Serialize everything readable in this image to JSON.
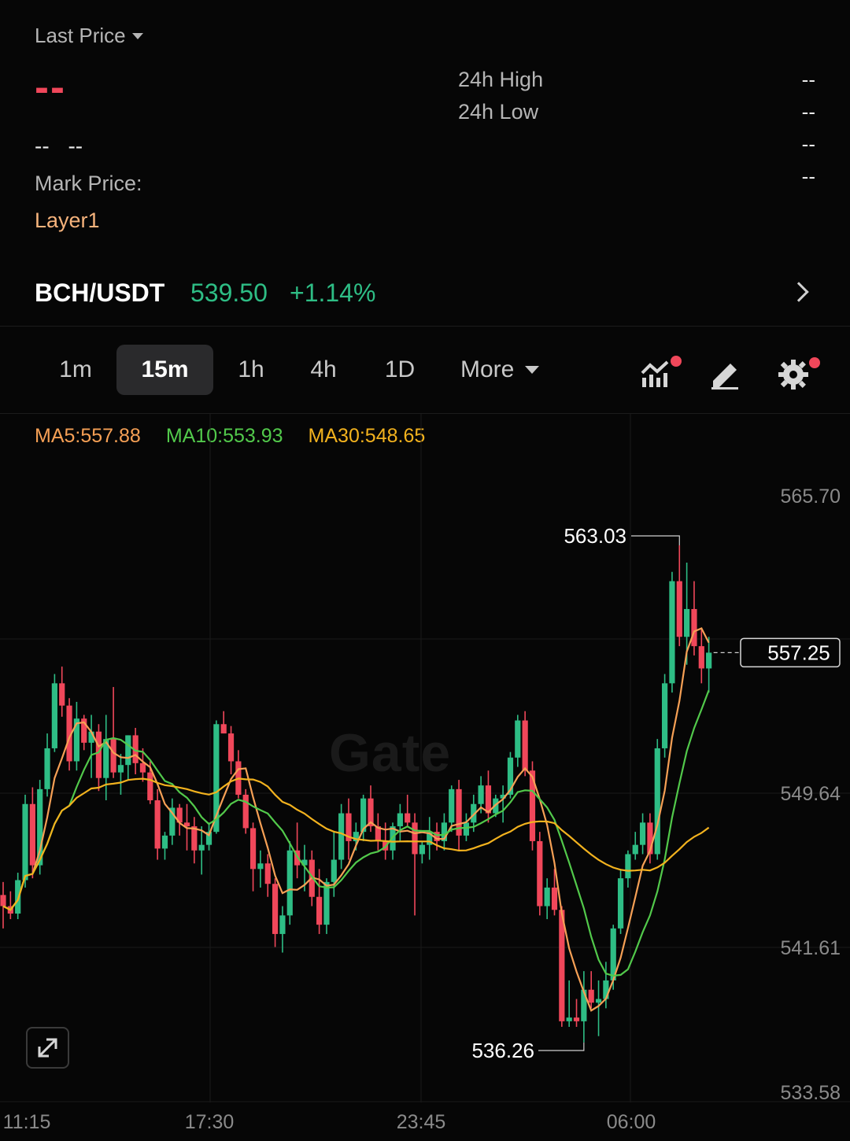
{
  "header": {
    "last_price_label": "Last Price",
    "last_price_value": "--",
    "change_left": "--",
    "change_right": "--",
    "mark_price_label": "Mark Price:",
    "tag": "Layer1",
    "stats": [
      {
        "label": "24h High",
        "value": "--"
      },
      {
        "label": "24h Low",
        "value": "--"
      },
      {
        "label": "",
        "value": "--"
      },
      {
        "label": "",
        "value": "--"
      }
    ]
  },
  "pair": {
    "symbol": "BCH/USDT",
    "price": "539.50",
    "change": "+1.14%"
  },
  "timeframes": {
    "items": [
      "1m",
      "15m",
      "1h",
      "4h",
      "1D"
    ],
    "active": "15m",
    "more_label": "More"
  },
  "tools": {
    "indicator_icon": "indicator-chart-icon",
    "draw_icon": "pencil-icon",
    "settings_icon": "gear-icon",
    "alert_color": "#f0475a"
  },
  "indicators": {
    "ma5": "MA5:557.88",
    "ma10": "MA10:553.93",
    "ma30": "MA30:548.65"
  },
  "watermark": "Gate",
  "chart_data": {
    "type": "candlestick",
    "up_color": "#2ebd85",
    "down_color": "#f0475a",
    "y_ticks": [
      "565.70",
      "549.64",
      "541.61",
      "533.58"
    ],
    "x_ticks": [
      "11:15",
      "17:30",
      "23:45",
      "06:00"
    ],
    "ylim": [
      533.58,
      565.7
    ],
    "current_price": "557.25",
    "max_label": "563.03",
    "min_label": "536.26",
    "ohlc": [
      [
        544.2,
        544.9,
        542.4,
        543.6
      ],
      [
        543.6,
        544.4,
        542.9,
        543.2
      ],
      [
        543.2,
        545.4,
        542.9,
        545.0
      ],
      [
        545.0,
        549.6,
        544.6,
        549.1
      ],
      [
        549.1,
        550.0,
        545.1,
        545.8
      ],
      [
        545.8,
        550.4,
        545.3,
        549.9
      ],
      [
        549.9,
        552.9,
        549.5,
        552.1
      ],
      [
        552.1,
        556.1,
        551.9,
        555.6
      ],
      [
        555.6,
        556.5,
        553.8,
        554.4
      ],
      [
        554.4,
        554.8,
        550.9,
        551.4
      ],
      [
        551.4,
        554.6,
        550.9,
        553.7
      ],
      [
        553.7,
        553.9,
        552.0,
        552.4
      ],
      [
        552.4,
        553.9,
        550.5,
        553.0
      ],
      [
        553.0,
        553.4,
        549.8,
        550.5
      ],
      [
        550.5,
        553.9,
        549.3,
        552.6
      ],
      [
        552.6,
        555.4,
        550.5,
        550.8
      ],
      [
        550.8,
        551.8,
        549.6,
        551.2
      ],
      [
        551.2,
        552.8,
        550.4,
        552.8
      ],
      [
        552.8,
        553.2,
        550.7,
        551.3
      ],
      [
        551.3,
        552.1,
        550.3,
        550.8
      ],
      [
        550.8,
        551.4,
        549.1,
        549.3
      ],
      [
        549.3,
        549.9,
        546.1,
        546.7
      ],
      [
        546.7,
        547.6,
        546.1,
        547.4
      ],
      [
        547.4,
        549.4,
        546.9,
        548.9
      ],
      [
        548.9,
        549.1,
        547.4,
        548.1
      ],
      [
        548.1,
        549.1,
        546.6,
        547.9
      ],
      [
        547.9,
        548.4,
        545.9,
        546.6
      ],
      [
        546.6,
        547.9,
        545.3,
        546.9
      ],
      [
        546.9,
        548.1,
        546.6,
        547.6
      ],
      [
        547.6,
        553.6,
        547.5,
        553.4
      ],
      [
        553.4,
        554.1,
        552.9,
        552.9
      ],
      [
        552.9,
        553.3,
        550.7,
        551.4
      ],
      [
        551.4,
        552.0,
        549.4,
        549.6
      ],
      [
        549.6,
        549.9,
        547.5,
        547.8
      ],
      [
        547.8,
        548.1,
        544.4,
        545.6
      ],
      [
        545.6,
        546.6,
        544.6,
        545.9
      ],
      [
        545.9,
        546.4,
        544.1,
        544.8
      ],
      [
        544.8,
        545.1,
        541.4,
        542.1
      ],
      [
        542.1,
        543.6,
        541.1,
        543.1
      ],
      [
        543.1,
        547.1,
        542.6,
        546.6
      ],
      [
        546.6,
        548.1,
        545.1,
        545.8
      ],
      [
        545.8,
        546.9,
        544.4,
        546.1
      ],
      [
        546.1,
        546.6,
        543.6,
        544.1
      ],
      [
        544.1,
        545.6,
        542.1,
        542.6
      ],
      [
        542.6,
        545.1,
        542.1,
        544.9
      ],
      [
        544.9,
        547.6,
        544.1,
        546.1
      ],
      [
        546.1,
        549.1,
        545.6,
        548.6
      ],
      [
        548.6,
        549.4,
        546.1,
        547.1
      ],
      [
        547.1,
        548.1,
        546.6,
        547.6
      ],
      [
        547.6,
        549.6,
        547.1,
        549.4
      ],
      [
        549.4,
        550.1,
        547.6,
        547.9
      ],
      [
        547.9,
        548.6,
        546.6,
        547.1
      ],
      [
        547.1,
        548.1,
        546.1,
        546.6
      ],
      [
        546.6,
        548.1,
        546.1,
        547.9
      ],
      [
        547.9,
        549.1,
        547.1,
        548.6
      ],
      [
        548.6,
        549.6,
        547.9,
        548.1
      ],
      [
        548.1,
        548.6,
        543.1,
        546.4
      ],
      [
        546.4,
        547.1,
        545.9,
        546.9
      ],
      [
        546.9,
        548.4,
        546.1,
        547.6
      ],
      [
        547.6,
        548.1,
        546.6,
        547.1
      ],
      [
        547.1,
        548.6,
        546.6,
        548.1
      ],
      [
        548.1,
        550.1,
        547.6,
        549.9
      ],
      [
        549.9,
        550.4,
        546.6,
        547.4
      ],
      [
        547.4,
        548.6,
        547.1,
        548.1
      ],
      [
        548.1,
        549.6,
        547.6,
        549.1
      ],
      [
        549.1,
        550.6,
        548.6,
        550.1
      ],
      [
        550.1,
        550.9,
        548.1,
        548.6
      ],
      [
        548.6,
        549.6,
        548.4,
        549.4
      ],
      [
        549.4,
        550.1,
        548.1,
        549.6
      ],
      [
        549.6,
        551.9,
        549.4,
        551.6
      ],
      [
        551.6,
        553.9,
        551.1,
        553.6
      ],
      [
        553.6,
        554.1,
        550.6,
        550.9
      ],
      [
        550.9,
        551.4,
        546.6,
        547.1
      ],
      [
        547.1,
        547.6,
        543.1,
        543.6
      ],
      [
        543.6,
        545.1,
        542.9,
        544.6
      ],
      [
        544.6,
        545.6,
        543.1,
        543.4
      ],
      [
        543.4,
        543.6,
        537.1,
        537.4
      ],
      [
        537.4,
        539.6,
        537.1,
        537.6
      ],
      [
        537.6,
        538.6,
        537.1,
        537.4
      ],
      [
        537.4,
        540.1,
        536.26,
        539.1
      ],
      [
        539.1,
        540.1,
        538.1,
        538.4
      ],
      [
        538.4,
        539.6,
        536.6,
        538.6
      ],
      [
        538.6,
        540.6,
        538.1,
        539.6
      ],
      [
        539.6,
        542.6,
        539.1,
        542.4
      ],
      [
        542.4,
        545.6,
        542.1,
        545.1
      ],
      [
        545.1,
        546.6,
        544.6,
        546.4
      ],
      [
        546.4,
        547.6,
        546.1,
        546.9
      ],
      [
        546.9,
        548.6,
        546.4,
        548.1
      ],
      [
        548.1,
        548.6,
        545.9,
        546.4
      ],
      [
        546.4,
        552.6,
        546.1,
        552.1
      ],
      [
        552.1,
        556.1,
        551.6,
        555.6
      ],
      [
        555.6,
        561.6,
        555.1,
        561.1
      ],
      [
        561.1,
        563.03,
        557.6,
        558.1
      ],
      [
        558.1,
        562.1,
        556.6,
        559.6
      ],
      [
        559.6,
        561.1,
        557.1,
        557.6
      ],
      [
        557.6,
        558.6,
        555.6,
        556.4
      ],
      [
        556.4,
        558.1,
        555.1,
        557.25
      ]
    ],
    "ma_series": [
      {
        "name": "MA5",
        "color": "#f6a055"
      },
      {
        "name": "MA10",
        "color": "#52c94b"
      },
      {
        "name": "MA30",
        "color": "#f2b21e"
      }
    ]
  }
}
